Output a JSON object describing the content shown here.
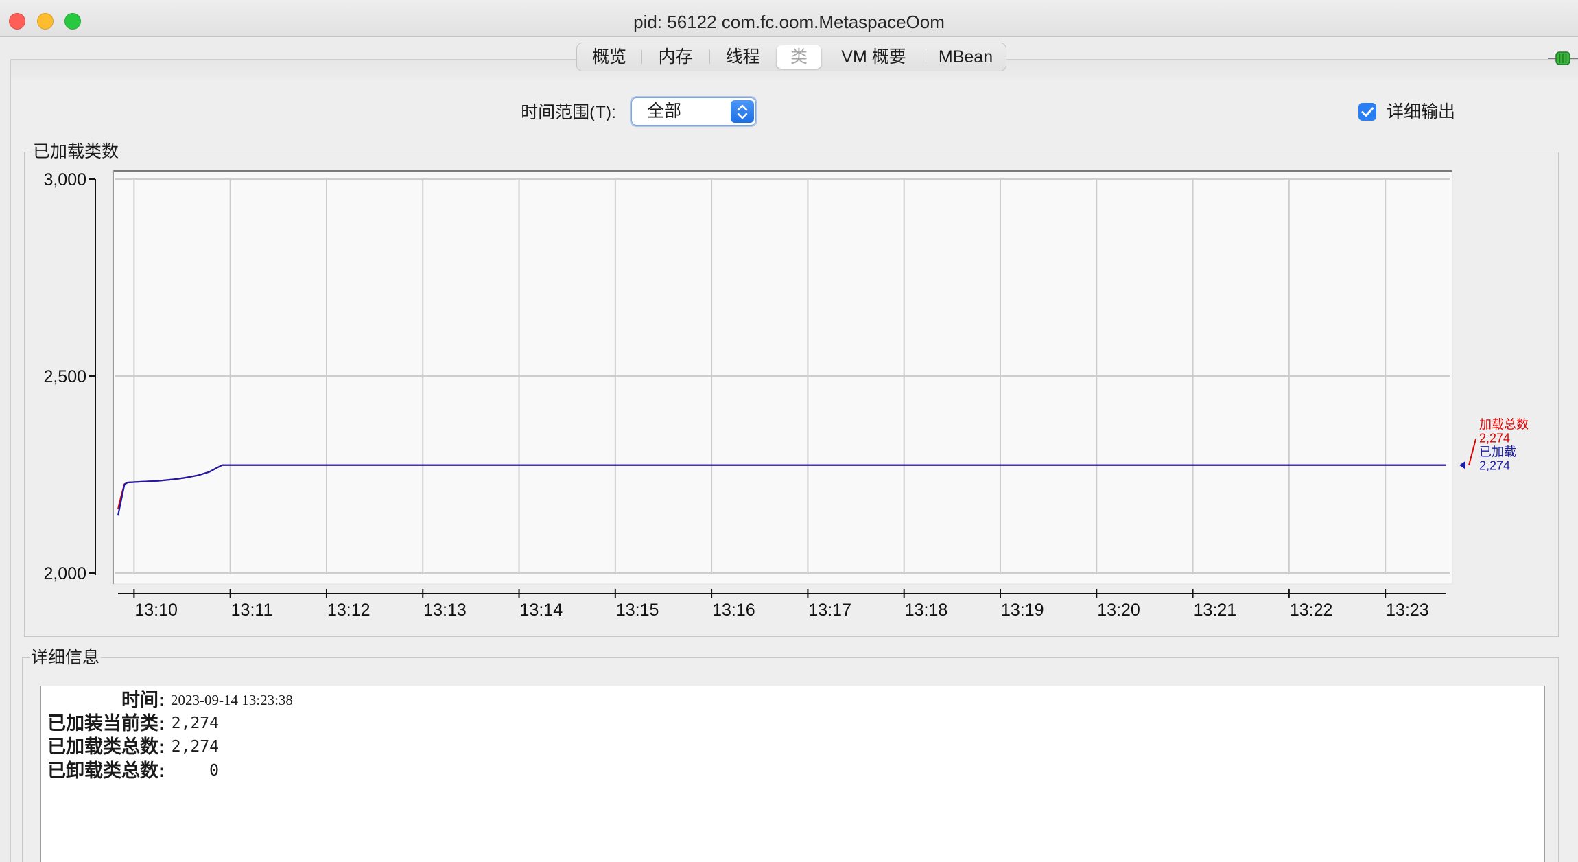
{
  "window": {
    "title": "pid: 56122 com.fc.oom.MetaspaceOom",
    "controls": [
      "close-icon",
      "minimize-icon",
      "zoom-icon"
    ]
  },
  "tabs": [
    {
      "label": "概览",
      "selected": false
    },
    {
      "label": "内存",
      "selected": false
    },
    {
      "label": "线程",
      "selected": false
    },
    {
      "label": "类",
      "selected": true
    },
    {
      "label": "VM 概要",
      "selected": false
    },
    {
      "label": "MBean",
      "selected": false
    }
  ],
  "toolbar": {
    "time_range": {
      "label": "时间范围(T):",
      "value": "全部"
    },
    "verbose_output": {
      "label": "详细输出",
      "checked": true
    }
  },
  "icons": {
    "connection": "connection-plug-icon",
    "dropdown": "chevron-up-down-icon",
    "checkbox": "checkmark-icon"
  },
  "colors": {
    "accent": "#2a7ef4",
    "close": "#ff5f57",
    "minimize": "#febc2e",
    "zoom": "#28c840"
  },
  "chart_data": {
    "type": "line",
    "title": "已加载类数",
    "xlim": [
      "13:09:50",
      "13:23:38"
    ],
    "ylim": [
      2000,
      3000
    ],
    "x_tick_labels": [
      "13:10",
      "13:11",
      "13:12",
      "13:13",
      "13:14",
      "13:15",
      "13:16",
      "13:17",
      "13:18",
      "13:19",
      "13:20",
      "13:21",
      "13:22",
      "13:23"
    ],
    "y_tick_labels": [
      "3,000",
      "2,500",
      "2,000"
    ],
    "grid": true,
    "legend": "right",
    "series": [
      {
        "name": "加载总数",
        "color": "#e00000",
        "value_label": "2,274",
        "points": [
          [
            "13:09:50",
            2162
          ],
          [
            "13:09:52",
            2196
          ],
          [
            "13:09:54",
            2226
          ],
          [
            "13:09:56",
            2230
          ],
          [
            "13:10:05",
            2232
          ],
          [
            "13:10:15",
            2234
          ],
          [
            "13:10:25",
            2238
          ],
          [
            "13:10:32",
            2242
          ],
          [
            "13:10:40",
            2248
          ],
          [
            "13:10:47",
            2257
          ],
          [
            "13:10:52",
            2268
          ],
          [
            "13:10:55",
            2274
          ],
          [
            "13:23:38",
            2274
          ]
        ]
      },
      {
        "name": "已加载",
        "color": "#1c1ca8",
        "value_label": "2,274",
        "points": [
          [
            "13:09:50",
            2146
          ],
          [
            "13:09:54",
            2225
          ],
          [
            "13:09:56",
            2230
          ],
          [
            "13:10:05",
            2232
          ],
          [
            "13:10:15",
            2234
          ],
          [
            "13:10:25",
            2238
          ],
          [
            "13:10:32",
            2242
          ],
          [
            "13:10:40",
            2248
          ],
          [
            "13:10:47",
            2257
          ],
          [
            "13:10:52",
            2268
          ],
          [
            "13:10:55",
            2274
          ],
          [
            "13:23:38",
            2274
          ]
        ]
      }
    ]
  },
  "details": {
    "title": "详细信息",
    "rows": [
      {
        "label": "时间:",
        "value": "2023-09-14 13:23:38"
      },
      {
        "label": "已加装当前类:",
        "value": "2,274"
      },
      {
        "label": "已加载类总数:",
        "value": "2,274"
      },
      {
        "label": "已卸载类总数:",
        "value": "0"
      }
    ]
  }
}
